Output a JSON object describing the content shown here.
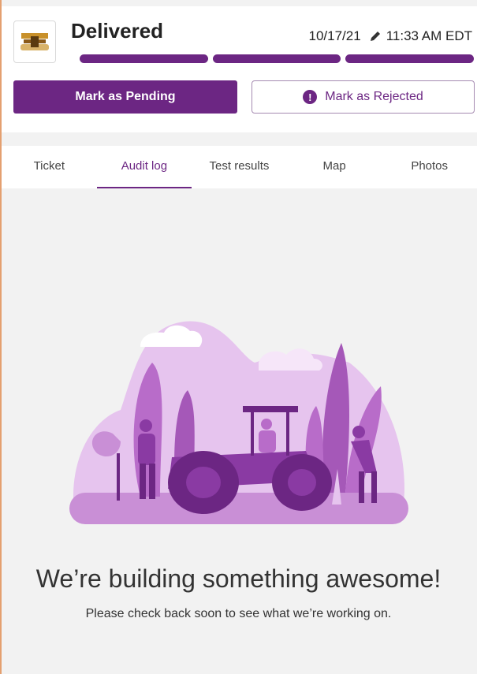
{
  "header": {
    "status": "Delivered",
    "date": "10/17/21",
    "time": "11:33 AM EDT",
    "logo_icon": "company-logo",
    "edit_icon": "pencil-icon",
    "progress_segments_filled": 3,
    "progress_segments_total": 3
  },
  "actions": {
    "pending_label": "Mark as Pending",
    "rejected_label": "Mark as Rejected",
    "rejected_icon": "alert-icon"
  },
  "tabs": [
    {
      "label": "Ticket",
      "active": false
    },
    {
      "label": "Audit log",
      "active": true
    },
    {
      "label": "Test results",
      "active": false
    },
    {
      "label": "Map",
      "active": false
    },
    {
      "label": "Photos",
      "active": false
    }
  ],
  "empty_state": {
    "illustration": "road-construction-illustration",
    "headline": "We’re building something awesome!",
    "subtext": "Please check back soon to see what we’re working on."
  },
  "colors": {
    "primary": "#6c2683",
    "background": "#f2f2f2",
    "illustration_light": "#e6c4ee",
    "illustration_mid": "#b86cc9",
    "illustration_dark": "#6c2683"
  }
}
